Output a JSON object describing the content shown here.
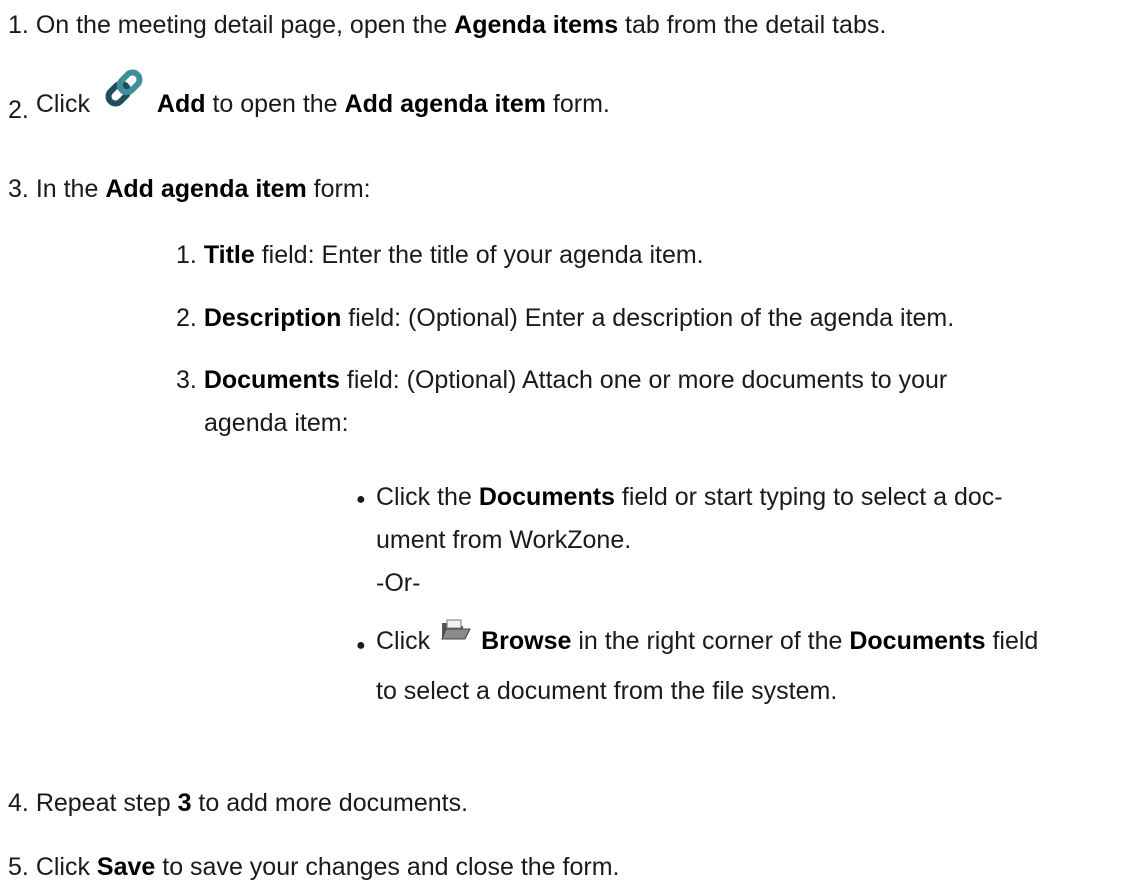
{
  "steps": [
    {
      "number": "1.",
      "parts": [
        "On the meeting detail page, open the ",
        "Agenda items",
        " tab from the detail tabs."
      ]
    },
    {
      "number": "2.",
      "parts": [
        "Click ",
        "Add",
        " to open the ",
        "Add agenda item",
        " form."
      ],
      "icon": "link-icon"
    },
    {
      "number": "3.",
      "parts": [
        "In the ",
        "Add agenda item",
        " form:"
      ],
      "substeps": [
        {
          "number": "1.",
          "parts": [
            "Title",
            " field: Enter the title of your agenda item."
          ]
        },
        {
          "number": "2.",
          "parts": [
            "Description",
            " field: (Optional) Enter a description of the agenda item."
          ]
        },
        {
          "number": "3.",
          "parts": [
            "Documents",
            " field: (Optional) Attach one or more documents to your"
          ],
          "continuation": "agenda item:",
          "bullets": [
            {
              "parts": [
                "Click the ",
                "Documents",
                " field or start typing to select a doc-"
              ],
              "continuation": "ument from WorkZone.",
              "or_text": "-Or-"
            },
            {
              "parts": [
                "Click ",
                "Browse",
                " in the right corner of the ",
                "Documents",
                " field"
              ],
              "continuation": "to select a document from the file system.",
              "icon": "folder-open-icon"
            }
          ]
        }
      ]
    },
    {
      "number": "4.",
      "parts": [
        "Repeat step ",
        "3",
        " to add more documents."
      ]
    },
    {
      "number": "5.",
      "parts": [
        "Click ",
        "Save",
        " to save your changes and close the form."
      ]
    }
  ],
  "colors": {
    "text": "#1a1a1a",
    "icon_dark": "#1f4f5a",
    "icon_light": "#3f8f9b"
  }
}
